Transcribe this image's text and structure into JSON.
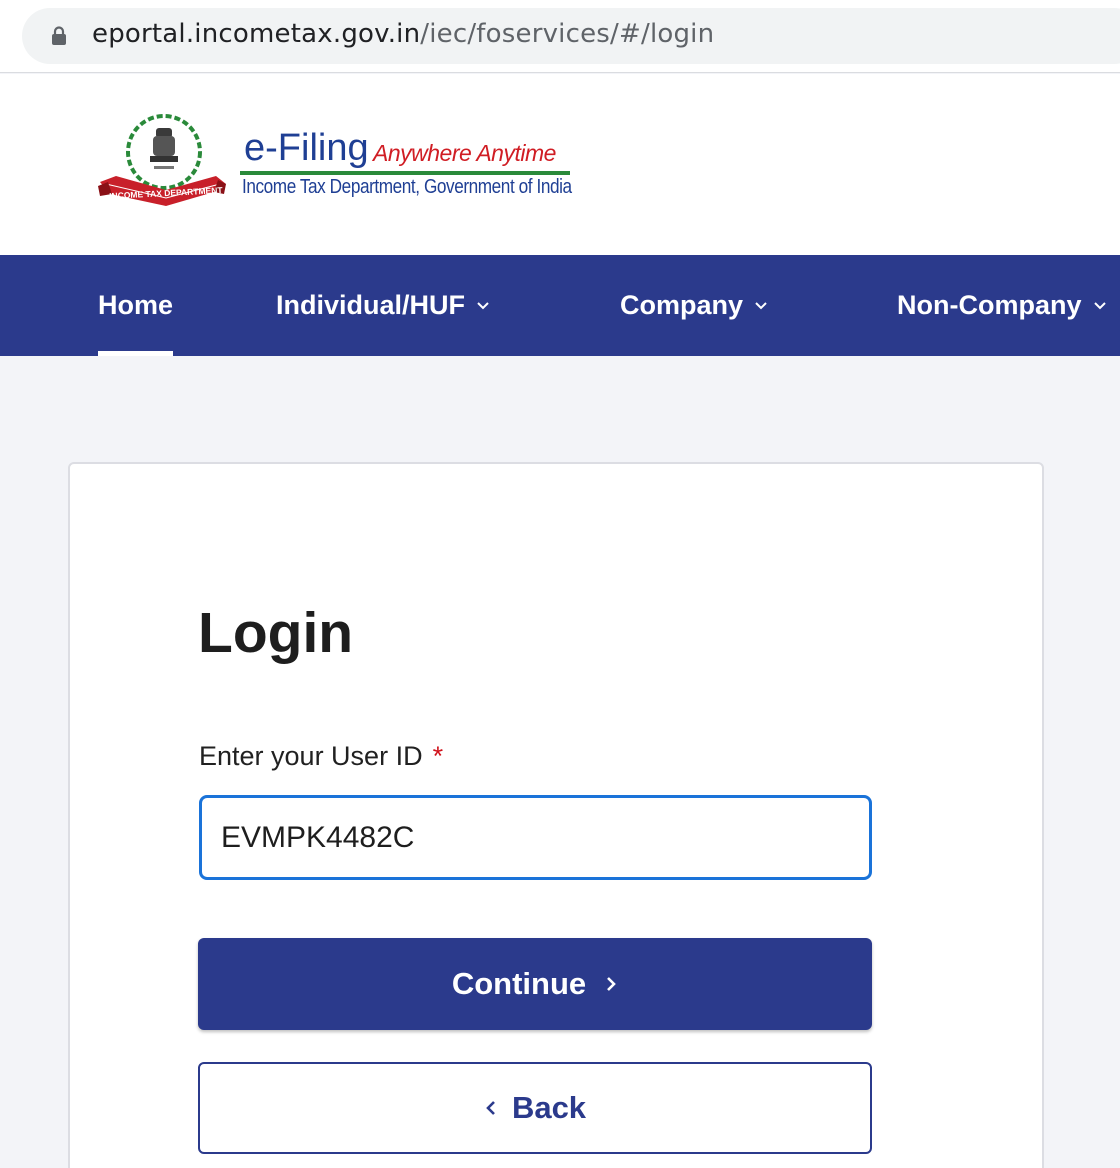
{
  "browser": {
    "url_domain": "eportal.incometax.gov.in",
    "url_path": "/iec/foservices/#/login",
    "lock_icon": "lock-icon"
  },
  "header": {
    "emblem_text": "INCOME TAX DEPARTMENT",
    "brand_title": "e-Filing",
    "brand_tagline": "Anywhere Anytime",
    "brand_subtitle": "Income Tax Department, Government of India"
  },
  "nav": {
    "items": [
      {
        "label": "Home",
        "active": true
      },
      {
        "label": "Individual/HUF",
        "dropdown": true
      },
      {
        "label": "Company",
        "dropdown": true
      },
      {
        "label": "Non-Company",
        "dropdown": true
      }
    ]
  },
  "login": {
    "title": "Login",
    "userid_label": "Enter your User ID",
    "required_marker": "*",
    "userid_value": "EVMPK4482C",
    "continue_label": "Continue",
    "back_label": "Back"
  },
  "colors": {
    "nav_bg": "#2b3a8c",
    "input_focus": "#1a73d9",
    "required": "#d0121b",
    "brand_blue": "#1f3f94",
    "brand_red": "#d01d24",
    "brand_green": "#2a8a3a"
  }
}
